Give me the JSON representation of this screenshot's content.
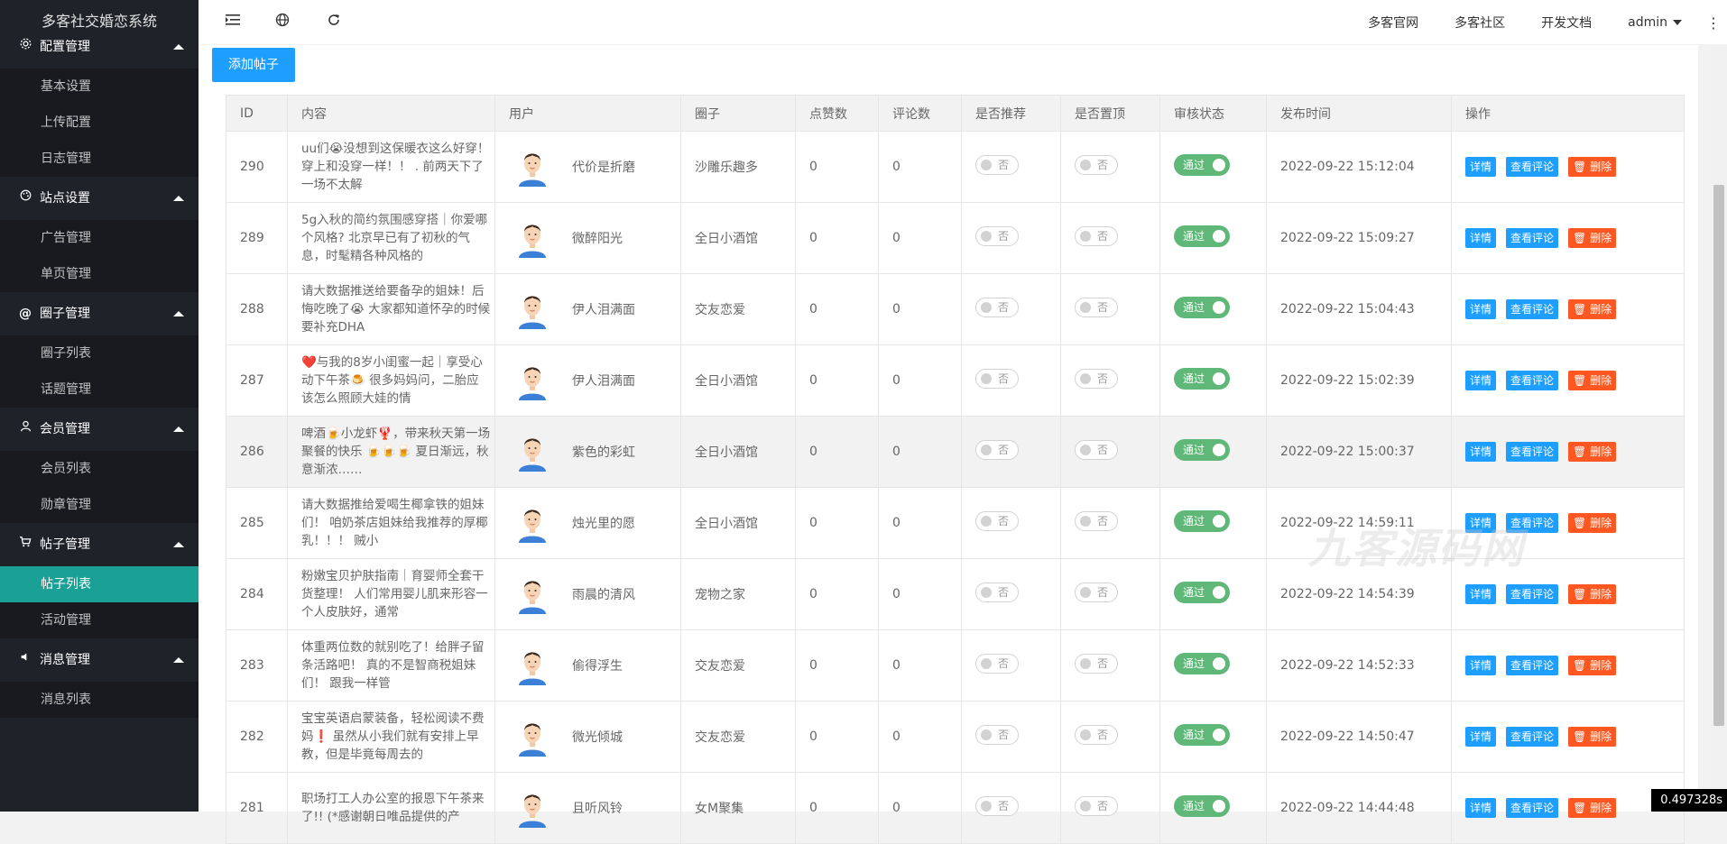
{
  "app": {
    "title": "多客社交婚恋系统"
  },
  "sidebar": {
    "groups": [
      {
        "title": "配置管理",
        "icon": "gear-icon",
        "items": [
          {
            "label": "基本设置"
          },
          {
            "label": "上传配置"
          },
          {
            "label": "日志管理"
          }
        ]
      },
      {
        "title": "站点设置",
        "icon": "palette-icon",
        "items": [
          {
            "label": "广告管理"
          },
          {
            "label": "单页管理"
          }
        ]
      },
      {
        "title": "圈子管理",
        "icon": "at-icon",
        "items": [
          {
            "label": "圈子列表"
          },
          {
            "label": "话题管理"
          }
        ]
      },
      {
        "title": "会员管理",
        "icon": "user-icon",
        "items": [
          {
            "label": "会员列表"
          },
          {
            "label": "勋章管理"
          }
        ]
      },
      {
        "title": "帖子管理",
        "icon": "cart-icon",
        "items": [
          {
            "label": "帖子列表",
            "active": true
          },
          {
            "label": "活动管理"
          }
        ]
      },
      {
        "title": "消息管理",
        "icon": "speaker-icon",
        "items": [
          {
            "label": "消息列表"
          }
        ]
      }
    ]
  },
  "topbar": {
    "links": [
      "多客官网",
      "多客社区",
      "开发文档"
    ],
    "user": "admin"
  },
  "main": {
    "add_button": "添加帖子",
    "columns": [
      "ID",
      "内容",
      "用户",
      "圈子",
      "点赞数",
      "评论数",
      "是否推荐",
      "是否置顶",
      "审核状态",
      "发布时间",
      "操作"
    ],
    "toggle_off_label": "否",
    "toggle_on_label": "通过",
    "actions": {
      "detail": "详情",
      "comments": "查看评论",
      "delete": "删除"
    },
    "rows": [
      {
        "id": "290",
        "content": "uu们😭没想到这保暖衣这么好穿！穿上和没穿一样！！ . 前两天下了一场不太解",
        "user": "代价是折磨",
        "circle": "沙雕乐趣多",
        "likes": "0",
        "comments": "0",
        "time": "2022-09-22 15:12:04"
      },
      {
        "id": "289",
        "content": "5g入秋的简约氛围感穿搭｜你爱哪个风格? 北京早已有了初秋的气息，时髦精各种风格的",
        "user": "微醉阳光",
        "circle": "全日小酒馆",
        "likes": "0",
        "comments": "0",
        "time": "2022-09-22 15:09:27"
      },
      {
        "id": "288",
        "content": "请大数据推送给要备孕的姐妹！后悔吃晚了😭 大家都知道怀孕的时候要补充DHA",
        "user": "伊人泪满面",
        "circle": "交友恋爱",
        "likes": "0",
        "comments": "0",
        "time": "2022-09-22 15:04:43"
      },
      {
        "id": "287",
        "content": "❤️与我的8岁小闺蜜一起｜享受心动下午茶🍮 很多妈妈问，二胎应该怎么照顾大娃的情",
        "user": "伊人泪满面",
        "circle": "全日小酒馆",
        "likes": "0",
        "comments": "0",
        "time": "2022-09-22 15:02:39"
      },
      {
        "id": "286",
        "content": "啤酒🍺小龙虾🦞，带来秋天第一场聚餐的快乐 🍺🍺🍺 夏日渐远，秋意渐浓……",
        "user": "紫色的彩虹",
        "circle": "全日小酒馆",
        "likes": "0",
        "comments": "0",
        "time": "2022-09-22 15:00:37",
        "highlight": true
      },
      {
        "id": "285",
        "content": "请大数据推给爱喝生椰拿铁的姐妹们！ 咱奶茶店姐妹给我推荐的厚椰乳！！！ 贼小",
        "user": "烛光里的愿",
        "circle": "全日小酒馆",
        "likes": "0",
        "comments": "0",
        "time": "2022-09-22 14:59:11"
      },
      {
        "id": "284",
        "content": "粉嫩宝贝护肤指南｜育婴师全套干货整理！ 人们常用婴儿肌来形容一个人皮肤好，通常",
        "user": "雨晨的清风",
        "circle": "宠物之家",
        "likes": "0",
        "comments": "0",
        "time": "2022-09-22 14:54:39"
      },
      {
        "id": "283",
        "content": "体重两位数的就别吃了！给胖子留条活路吧！ 真的不是智商税姐妹们！ 跟我一样管",
        "user": "偷得浮生",
        "circle": "交友恋爱",
        "likes": "0",
        "comments": "0",
        "time": "2022-09-22 14:52:33"
      },
      {
        "id": "282",
        "content": "宝宝英语启蒙装备，轻松阅读不费妈❗ 虽然从小我们就有安排上早教，但是毕竟每周去的",
        "user": "微光倾城",
        "circle": "交友恋爱",
        "likes": "0",
        "comments": "0",
        "time": "2022-09-22 14:50:47"
      },
      {
        "id": "281",
        "content": "职场打工人办公室的报恩下午茶来了!! (*感谢朝日唯品提供的产",
        "user": "且听风铃",
        "circle": "女M聚集",
        "likes": "0",
        "comments": "0",
        "time": "2022-09-22 14:44:48"
      }
    ]
  },
  "watermark": "九客源码网",
  "timer": "0.497328s"
}
